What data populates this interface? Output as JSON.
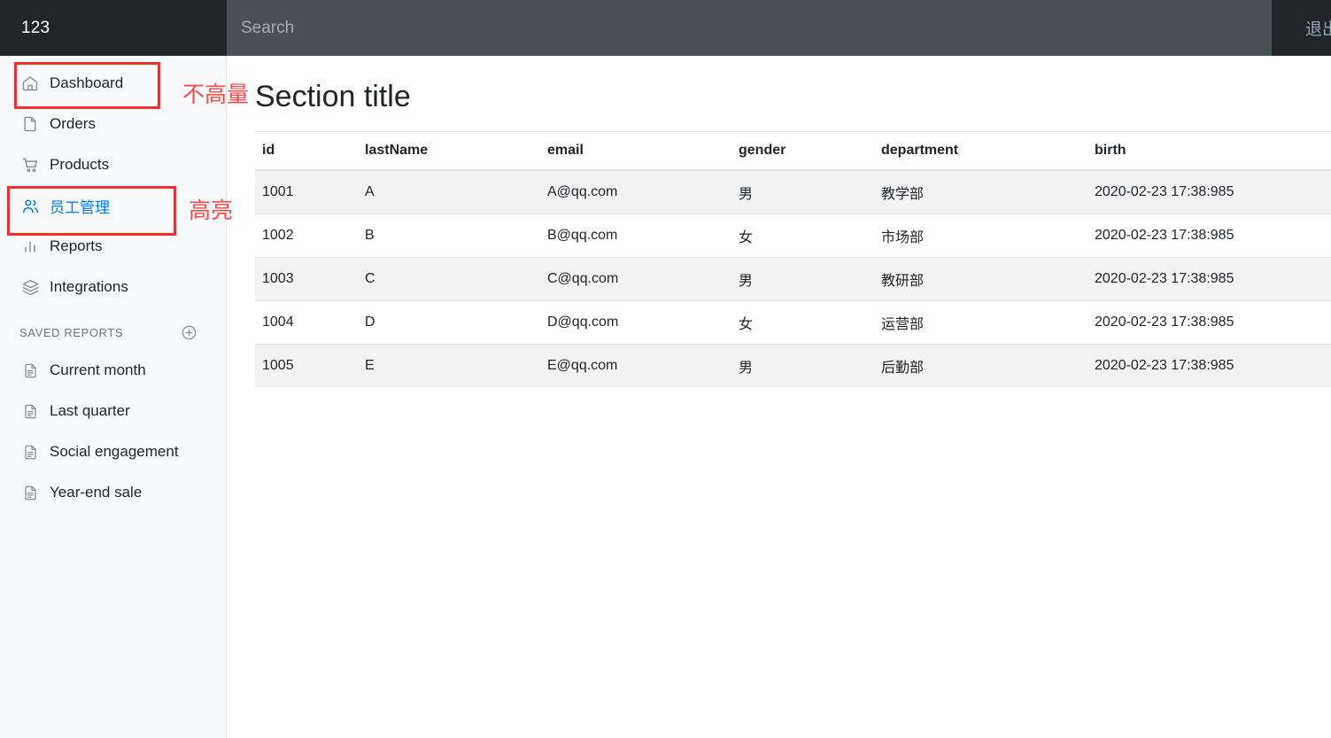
{
  "navbar": {
    "brand": "123",
    "search": {
      "placeholder": "Search",
      "value": "",
      "icon": "search-icon"
    },
    "logout_label": "退出登"
  },
  "sidebar": {
    "primary_items": [
      {
        "label": "Dashboard",
        "icon": "home-icon",
        "active": false
      },
      {
        "label": "Orders",
        "icon": "file-icon",
        "active": false
      },
      {
        "label": "Products",
        "icon": "shopping-cart-icon",
        "active": false
      },
      {
        "label": "员工管理",
        "icon": "people-icon",
        "active": true
      },
      {
        "label": "Reports",
        "icon": "bar-chart-icon",
        "active": false
      },
      {
        "label": "Integrations",
        "icon": "layers-icon",
        "active": false
      }
    ],
    "saved_reports": {
      "heading": "SAVED REPORTS",
      "add_icon": "plus-circle-icon",
      "items": [
        {
          "label": "Current month",
          "icon": "document-icon"
        },
        {
          "label": "Last quarter",
          "icon": "document-icon"
        },
        {
          "label": "Social engagement",
          "icon": "document-icon"
        },
        {
          "label": "Year-end sale",
          "icon": "document-icon"
        }
      ]
    }
  },
  "main": {
    "section_title": "Section title",
    "table": {
      "columns": [
        "id",
        "lastName",
        "email",
        "gender",
        "department",
        "birth"
      ],
      "rows": [
        [
          "1001",
          "A",
          "A@qq.com",
          "男",
          "教学部",
          "2020-02-23 17:38:985"
        ],
        [
          "1002",
          "B",
          "B@qq.com",
          "女",
          "市场部",
          "2020-02-23 17:38:985"
        ],
        [
          "1003",
          "C",
          "C@qq.com",
          "男",
          "教研部",
          "2020-02-23 17:38:985"
        ],
        [
          "1004",
          "D",
          "D@qq.com",
          "女",
          "运营部",
          "2020-02-23 17:38:985"
        ],
        [
          "1005",
          "E",
          "E@qq.com",
          "男",
          "后勤部",
          "2020-02-23 17:38:985"
        ]
      ]
    }
  },
  "annotations": {
    "not_highlighted": "不高量",
    "highlighted": "高亮",
    "color": "#fb4b4b"
  },
  "colors": {
    "navbar_bg": "#212529",
    "search_bg": "#495057",
    "sidebar_bg": "#f8f9fa",
    "active_link": "#007bff",
    "row_stripe": "#f2f2f2",
    "border": "#dee2e6"
  }
}
